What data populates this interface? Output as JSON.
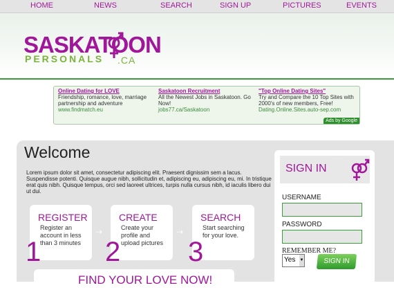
{
  "nav": [
    "HOME",
    "NEWS",
    "SEARCH",
    "SIGN UP",
    "PICTURES",
    "EVENTS"
  ],
  "logo": {
    "top": "SASKATOON",
    "bottom": "PERSONALS",
    "suffix": ".CA"
  },
  "ads": [
    {
      "title": "Online Dating for LOVE",
      "desc": "Friendship, romance, love, marriage partnership and adventure",
      "url": "www.findmatch.eu"
    },
    {
      "title": "Saskatoon Recruitment",
      "desc": "All the Newest Jobs in Saskatoon. Go Now!",
      "url": "jobs77.ca/Saskatoon"
    },
    {
      "title": "\"Top Online Dating Sites\"",
      "desc": "Try and Compare the 10 Top Sites with 2000's of new members, Free!",
      "url": "Dating.Online.Sites.auto-sep.com"
    }
  ],
  "ads_by": "Ads by Google",
  "main": {
    "title": "Welcome",
    "intro": "Lorem ipsum dolor sit amet, consectetur adipiscing elit. Praesent dignissim sem a lacus. Suspendisse potenti. Quisque augue nibh, sollicitudin et, adipiscing eu, adipiscing eu, mi. In tristique erat quis nibh. Quisque tempus, orci sed laoreet ultrices, turpis nulla cursus nibh, id iaculis libero dui ut dui.",
    "steps": [
      {
        "heading": "REGISTER",
        "text": "Register an account in less than 3 minutes",
        "num": "1"
      },
      {
        "heading": "CREATE",
        "text": "Create your profile and upload pictures",
        "num": "2"
      },
      {
        "heading": "SEARCH",
        "text": "Start searching for your love.",
        "num": "3"
      }
    ],
    "find": "FIND YOUR LOVE NOW!"
  },
  "signin": {
    "title": "SIGN IN",
    "username_label": "USERNAME",
    "password_label": "PASSWORD",
    "remember_label": "REMEMBER ME?",
    "remember_value": "Yes",
    "button": "SIGN IN"
  }
}
